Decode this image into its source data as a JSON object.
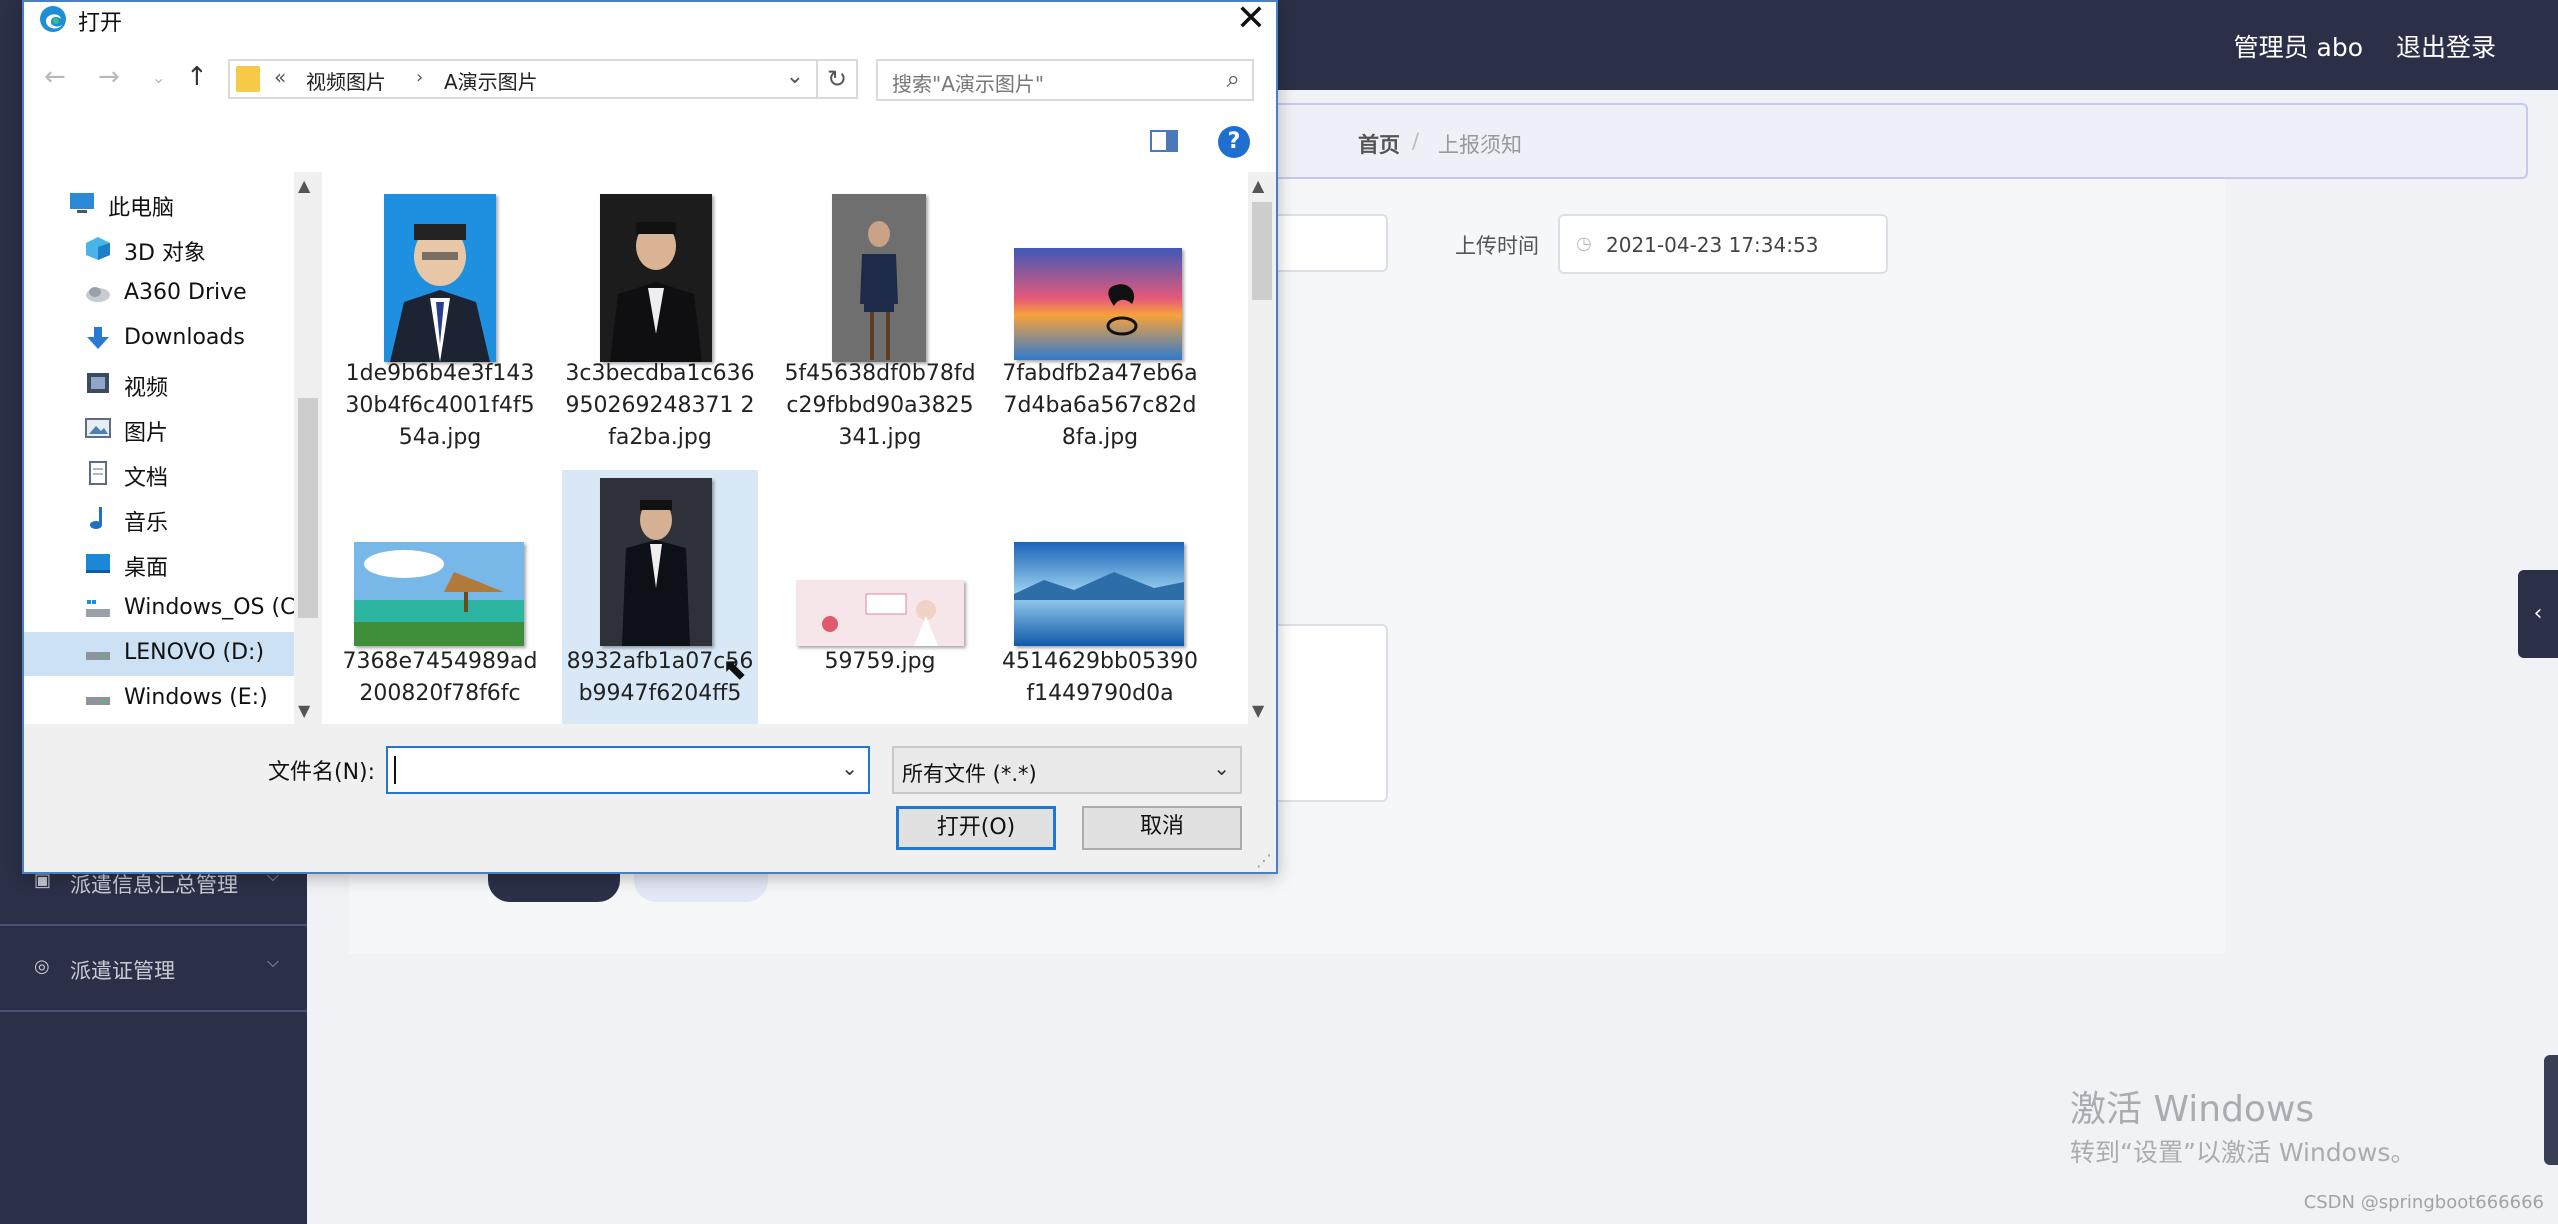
{
  "app": {
    "header": {
      "user": "管理员 abo",
      "logout": "退出登录"
    },
    "sidebar": {
      "items": [
        {
          "label": "派遣信息汇总管理",
          "icon": "clipboard-icon"
        },
        {
          "label": "派遣证管理",
          "icon": "compass-icon"
        }
      ]
    },
    "breadcrumb": {
      "home": "首页",
      "separator": "/",
      "current": "上报须知"
    },
    "form": {
      "upload_time_label": "上传时间",
      "upload_time_value": "2021-04-23 17:34:53"
    },
    "watermarks": {
      "activate_title": "激活 Windows",
      "activate_sub": "转到“设置”以激活 Windows。",
      "csdn": "CSDN @springboot666666"
    }
  },
  "dialog": {
    "title": "打开",
    "address": {
      "overflow": "«",
      "segments": [
        "视频图片",
        "A演示图片"
      ]
    },
    "search_placeholder": "搜索\"A演示图片\"",
    "nav_items": [
      {
        "label": "此电脑",
        "icon": "computer-icon"
      },
      {
        "label": "3D 对象",
        "icon": "cube-3d-icon"
      },
      {
        "label": "A360 Drive",
        "icon": "cloud-drive-icon"
      },
      {
        "label": "Downloads",
        "icon": "download-arrow-icon"
      },
      {
        "label": "视频",
        "icon": "video-icon"
      },
      {
        "label": "图片",
        "icon": "picture-icon"
      },
      {
        "label": "文档",
        "icon": "document-icon"
      },
      {
        "label": "音乐",
        "icon": "music-note-icon"
      },
      {
        "label": "桌面",
        "icon": "desktop-icon"
      },
      {
        "label": "Windows_OS (C",
        "icon": "drive-c-icon"
      },
      {
        "label": "LENOVO (D:)",
        "icon": "drive-d-icon"
      },
      {
        "label": "Windows (E:)",
        "icon": "drive-e-icon"
      }
    ],
    "files": [
      {
        "name": "1de9b6b4e3f14330b4f6c4001f4f554a.jpg",
        "thumb": "portrait-blue"
      },
      {
        "name": "3c3becdba1c636950269248371 2fa2ba.jpg",
        "thumb": "portrait-dark"
      },
      {
        "name": "5f45638df0b78fdc29fbbd90a3825341.jpg",
        "thumb": "portrait-stool"
      },
      {
        "name": "7fabdfb2a47eb6a7d4ba6a567c82d8fa.jpg",
        "thumb": "sunset-dolphin"
      },
      {
        "name": "7368e7454989ad200820f78f6fc",
        "thumb": "beach-hut"
      },
      {
        "name": "8932afb1a07c56b9947f6204ff5",
        "thumb": "portrait-suit"
      },
      {
        "name": "59759.jpg",
        "thumb": "wedding-banner"
      },
      {
        "name": "4514629bb05390f1449790d0a",
        "thumb": "lake-mountains"
      }
    ],
    "filename_label": "文件名(N):",
    "filename_value": "",
    "filetype": "所有文件 (*.*)",
    "open_button": "打开(O)",
    "cancel_button": "取消"
  }
}
